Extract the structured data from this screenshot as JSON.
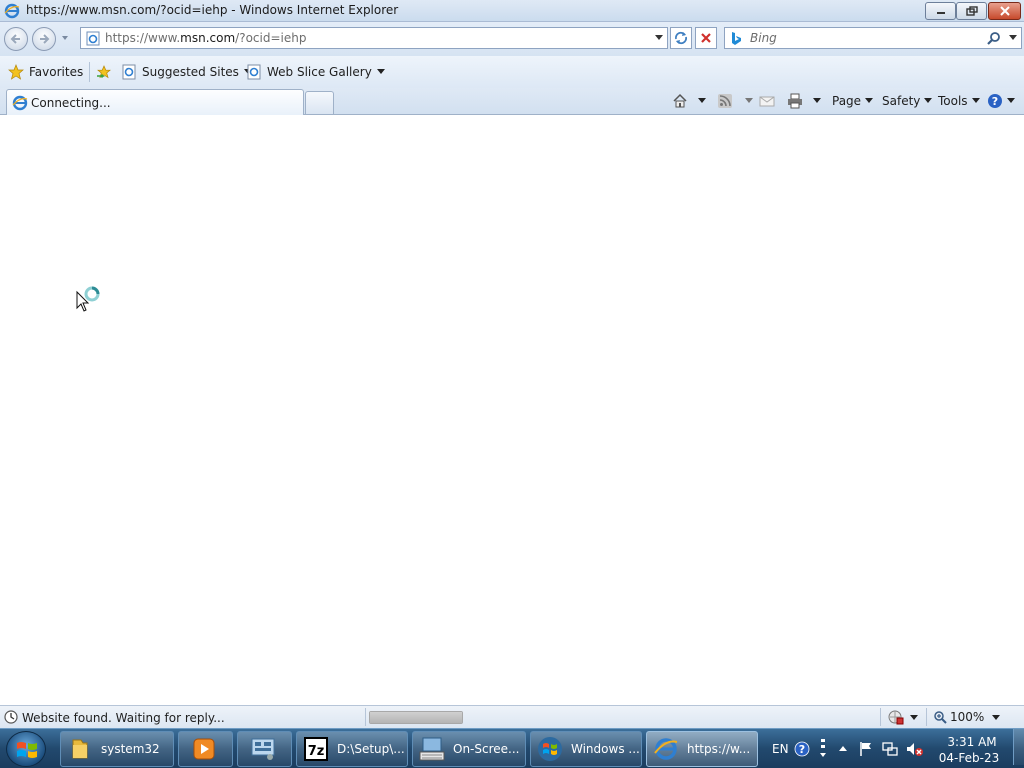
{
  "window": {
    "title": "https://www.msn.com/?ocid=iehp - Windows Internet Explorer",
    "buttons": {
      "minimize": "minimize-icon",
      "maximize": "restore-icon",
      "close": "close-icon"
    }
  },
  "address_bar": {
    "url_prefix": "https://www.",
    "url_domain": "msn.com",
    "url_suffix": "/?ocid=iehp"
  },
  "search": {
    "placeholder": "Bing"
  },
  "favorites_bar": {
    "favorites_label": "Favorites",
    "suggested_sites_label": "Suggested Sites",
    "web_slice_gallery_label": "Web Slice Gallery"
  },
  "tabs": [
    {
      "label": "Connecting..."
    }
  ],
  "command_bar": {
    "page_label": "Page",
    "safety_label": "Safety",
    "tools_label": "Tools"
  },
  "status_bar": {
    "message": "Website found. Waiting for reply...",
    "zoom": "100%"
  },
  "taskbar": {
    "items": [
      {
        "label": "system32"
      },
      {
        "label": ""
      },
      {
        "label": ""
      },
      {
        "label": "D:\\Setup\\..."
      },
      {
        "label": "On-Scree..."
      },
      {
        "label": "Windows ..."
      },
      {
        "label": "https://w..."
      }
    ],
    "tray": {
      "language": "EN",
      "time": "3:31 AM",
      "date": "04-Feb-23"
    }
  },
  "colors": {
    "title_bar": "#cbdcee",
    "taskbar": "#22496e",
    "close_button": "#c74a2c"
  }
}
